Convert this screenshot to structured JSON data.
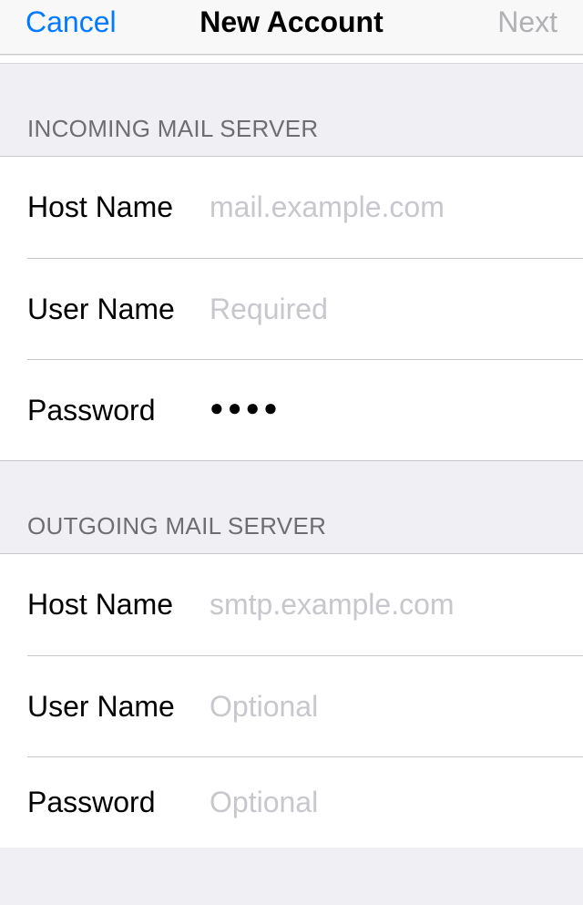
{
  "nav": {
    "cancel": "Cancel",
    "title": "New Account",
    "next": "Next"
  },
  "incoming": {
    "header": "INCOMING MAIL SERVER",
    "host_label": "Host Name",
    "host_placeholder": "mail.example.com",
    "host_value": "",
    "user_label": "User Name",
    "user_placeholder": "Required",
    "user_value": "",
    "pass_label": "Password",
    "pass_value": "••••"
  },
  "outgoing": {
    "header": "OUTGOING MAIL SERVER",
    "host_label": "Host Name",
    "host_placeholder": "smtp.example.com",
    "host_value": "",
    "user_label": "User Name",
    "user_placeholder": "Optional",
    "user_value": "",
    "pass_label": "Password",
    "pass_placeholder": "Optional",
    "pass_value": ""
  }
}
